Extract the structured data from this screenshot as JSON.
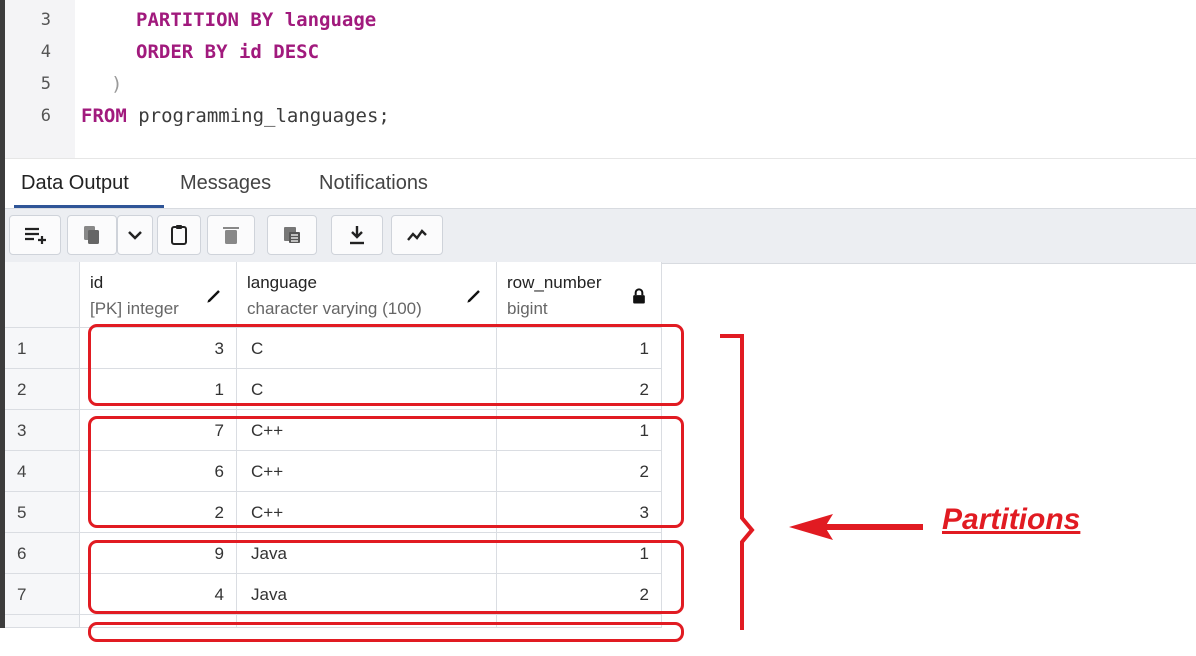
{
  "editor": {
    "lines": [
      {
        "num": "3",
        "parts": [
          {
            "t": "PARTITION BY ",
            "c": "kw"
          },
          {
            "t": "language",
            "c": "kw"
          }
        ]
      },
      {
        "num": "4",
        "parts": [
          {
            "t": "ORDER BY ",
            "c": "kw"
          },
          {
            "t": "id DESC",
            "c": "kw"
          }
        ]
      },
      {
        "num": "5",
        "parts": [
          {
            "t": ")",
            "c": "paren"
          }
        ]
      },
      {
        "num": "6",
        "parts": [
          {
            "t": "FROM ",
            "c": "kw"
          },
          {
            "t": "programming_languages;",
            "c": "id"
          }
        ]
      }
    ]
  },
  "tabs": {
    "data_output": "Data Output",
    "messages": "Messages",
    "notifications": "Notifications"
  },
  "toolbar": {
    "add_row_icon": "add-row-icon",
    "copy_icon": "copy-icon",
    "dropdown_icon": "chevron-down-icon",
    "paste_icon": "paste-icon",
    "delete_icon": "trash-icon",
    "save_data_icon": "save-data-icon",
    "download_icon": "download-icon",
    "graph_icon": "graph-icon"
  },
  "grid": {
    "columns": [
      {
        "name": "id",
        "type": "[PK] integer",
        "icon": "pencil-icon"
      },
      {
        "name": "language",
        "type": "character varying (100)",
        "icon": "pencil-icon"
      },
      {
        "name": "row_number",
        "type": "bigint",
        "icon": "lock-icon"
      }
    ],
    "rows": [
      {
        "rn": "1",
        "id": "3",
        "language": "C",
        "row_number": "1"
      },
      {
        "rn": "2",
        "id": "1",
        "language": "C",
        "row_number": "2"
      },
      {
        "rn": "3",
        "id": "7",
        "language": "C++",
        "row_number": "1"
      },
      {
        "rn": "4",
        "id": "6",
        "language": "C++",
        "row_number": "2"
      },
      {
        "rn": "5",
        "id": "2",
        "language": "C++",
        "row_number": "3"
      },
      {
        "rn": "6",
        "id": "9",
        "language": "Java",
        "row_number": "1"
      },
      {
        "rn": "7",
        "id": "4",
        "language": "Java",
        "row_number": "2"
      }
    ]
  },
  "annotation": {
    "label": "Partitions",
    "color": "#e11b22"
  }
}
